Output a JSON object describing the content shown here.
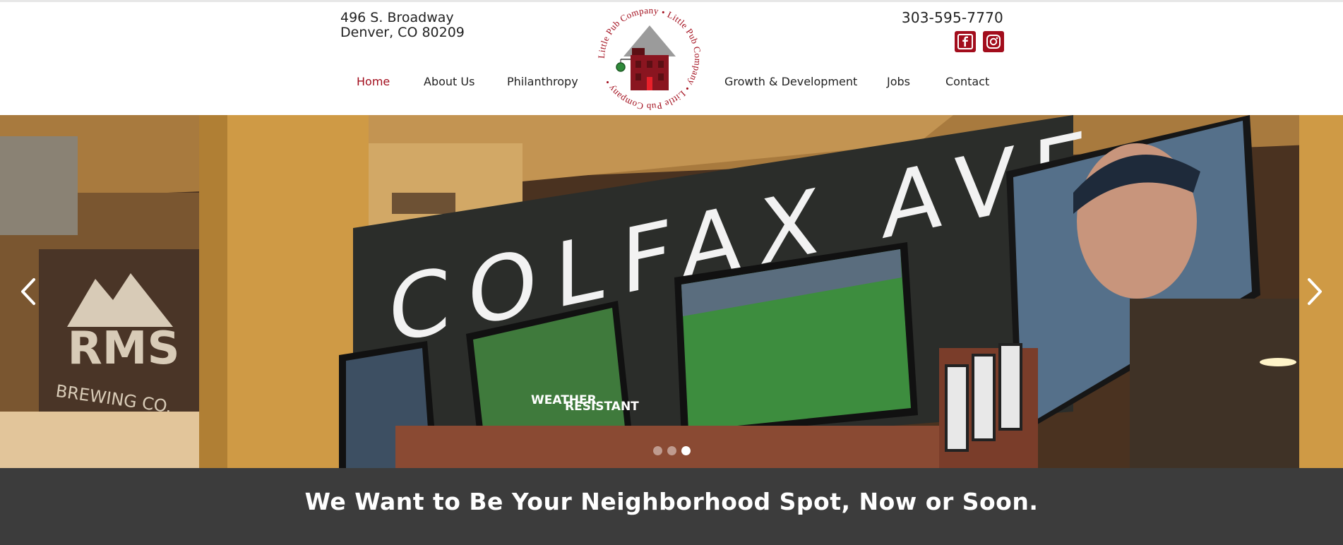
{
  "header": {
    "address_line1": "496 S. Broadway",
    "address_line2": "Denver, CO 80209",
    "phone": "303-595-7770",
    "social": [
      {
        "name": "facebook-icon",
        "glyph": "f"
      },
      {
        "name": "instagram-icon",
        "glyph": ""
      }
    ]
  },
  "logo": {
    "ring_text": "Little Pub Company • Little Pub Company • Little Pub Company •",
    "colors": {
      "brand": "#a20d1c",
      "roof": "#9b9b9b"
    }
  },
  "nav": {
    "items": [
      {
        "label": "Home",
        "active": true
      },
      {
        "label": "About Us"
      },
      {
        "label": "Philanthropy"
      },
      {
        "label": "Growth & Development"
      },
      {
        "label": "Jobs"
      },
      {
        "label": "Contact"
      }
    ]
  },
  "hero": {
    "wall_sign": "COLFAX AVE",
    "brewery_sign_line1": "RMS",
    "brewery_sign_line2": "BREWING CO.",
    "tv_text_1": "WEATHER",
    "tv_text_2": "RESISTANT",
    "slides": 3,
    "active_slide": 3
  },
  "banner": {
    "headline": "We Want to Be Your Neighborhood Spot, Now or Soon."
  },
  "colors": {
    "accent": "#a20d1c",
    "banner_bg": "#3c3c3c"
  }
}
